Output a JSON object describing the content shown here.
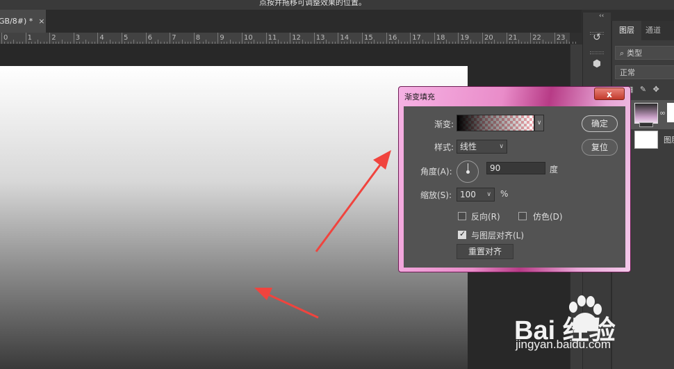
{
  "top_hint": "点按并拖移可调整效果的位置。",
  "document_tab": {
    "title": "GB/8#) *",
    "close": "×"
  },
  "ruler": {
    "numbers": [
      "0",
      "1",
      "2",
      "3",
      "4",
      "5",
      "6",
      "7",
      "8",
      "9",
      "10",
      "11",
      "12",
      "13",
      "14",
      "15",
      "16",
      "17",
      "18",
      "19",
      "20",
      "21",
      "22",
      "23"
    ]
  },
  "right_strip": {
    "collapse": "‹‹"
  },
  "layers_panel": {
    "tabs": [
      "图层",
      "通道"
    ],
    "filter_label": "类型",
    "blend_mode": "正常",
    "layer2_name": "图层"
  },
  "dialog": {
    "title": "渐变填充",
    "close": "x",
    "gradient_label": "渐变:",
    "style_label": "样式:",
    "style_value": "线性",
    "angle_label": "角度(A):",
    "angle_value": "90",
    "angle_unit": "度",
    "scale_label": "缩放(S):",
    "scale_value": "100",
    "scale_unit": "%",
    "reverse_label": "反向(R)",
    "dither_label": "仿色(D)",
    "align_label": "与图层对齐(L)",
    "align_checked": true,
    "realign_button": "重置对齐",
    "ok_button": "确定",
    "reset_button": "复位"
  },
  "watermark": {
    "brand": "Bai  经验",
    "url": "jingyan.baidu.com"
  },
  "colors": {
    "arrow": "#f0443e",
    "dialog_frame": "#e98cc9",
    "dialog_body": "#535353"
  }
}
